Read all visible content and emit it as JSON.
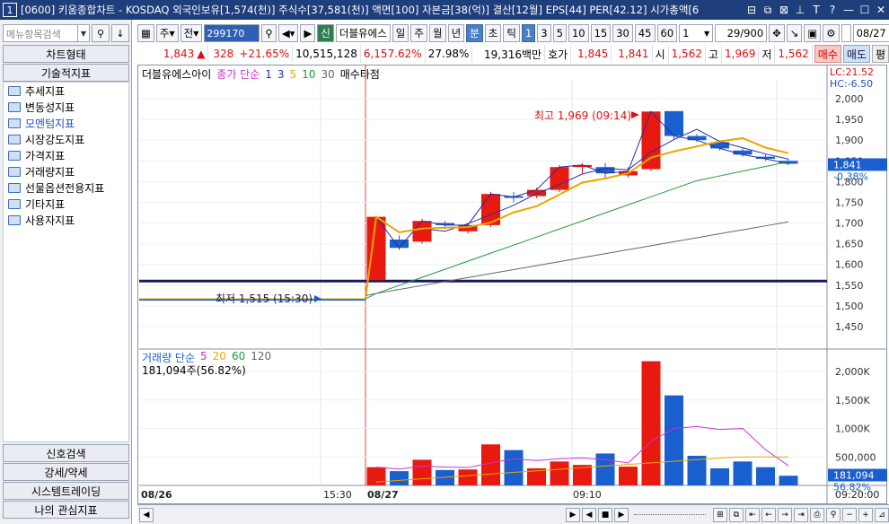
{
  "title": {
    "number": "1",
    "text": "[0600] 키움종합차트 - KOSDAQ 외국인보유[1,574(천)] 주식수[37,581(천)] 액면[100] 자본금[38(억)] 결산[12월] EPS[44] PER[42.12] 시가총액[6"
  },
  "sidebar": {
    "search_placeholder": "메뉴항목검색",
    "tab_chart_type": "차트형태",
    "tab_indicator": "기술적지표",
    "tree": [
      "추세지표",
      "변동성지표",
      "모멘텀지표",
      "시장강도지표",
      "가격지표",
      "거래량지표",
      "선물옵션전용지표",
      "기타지표",
      "사용자지표"
    ],
    "bottom_tabs": [
      "신호검색",
      "강세/약세",
      "시스템트레이딩",
      "나의 관심지표"
    ]
  },
  "toolbar": {
    "type1": "주",
    "type2": "전",
    "code": "299170",
    "sin": "신",
    "name": "더블유에스",
    "periods": [
      "일",
      "주",
      "월",
      "년",
      "분",
      "초",
      "틱"
    ],
    "minutes": [
      "1",
      "3",
      "5",
      "10",
      "15",
      "30",
      "45",
      "60"
    ],
    "mult": "1",
    "count": "29/900",
    "date": "08/27"
  },
  "quote": {
    "price": "1,843",
    "arrow": "▲",
    "change": "328",
    "rate": "+21.65%",
    "volume": "10,515,128",
    "vol_rate": "6,157.62%",
    "turnover": "27.98%",
    "amount": "19,316백만",
    "hoga_label": "호가",
    "ask": "1,845",
    "bid": "1,841",
    "open_l": "시",
    "open": "1,562",
    "high_l": "고",
    "high": "1,969",
    "low_l": "저",
    "low": "1,562",
    "buy": "매수",
    "sell": "매도",
    "eval": "평"
  },
  "legend": {
    "name": "더블유에스아이",
    "ma_label": "종가 단순",
    "ma": [
      "1",
      "3",
      "5",
      "10",
      "30"
    ],
    "signal": "매수타점"
  },
  "annotations": {
    "max": "최고 1,969 (09:14)",
    "min": "최저 1,515 (15:30)"
  },
  "price_axis": {
    "lc": "LC:21.52",
    "hc": "HC:-6.50",
    "ticks": [
      "2,000",
      "1,950",
      "1,900",
      "1,850",
      "1,800",
      "1,750",
      "1,700",
      "1,650",
      "1,600",
      "1,550",
      "1,500",
      "1,450"
    ],
    "current": "1,841",
    "current_rate": "-0.38%"
  },
  "volume": {
    "legend": "거래량 단순",
    "ma": [
      "5",
      "20",
      "60",
      "120"
    ],
    "value": "181,094주(56.82%)",
    "ticks": [
      "2,000K",
      "1,500K",
      "1,000K",
      "500,000"
    ],
    "current": "181,094",
    "rate": "56.82%"
  },
  "time_axis": {
    "labels": [
      "08/26",
      "15:30",
      "08/27",
      "09:10"
    ],
    "right": "09:20:00"
  },
  "colors": {
    "up": "#e8190f",
    "down": "#1a5fcf",
    "ma3": "#2233aa",
    "ma5": "#e8a800",
    "ma10": "#1d9b3a",
    "ma30": "#666666",
    "vol_ma5": "#cc33cc"
  },
  "chart_data": {
    "type": "candlestick",
    "candles": [
      {
        "o": 1562,
        "c": 1715,
        "h": 1715,
        "l": 1562
      },
      {
        "o": 1660,
        "c": 1640,
        "h": 1670,
        "l": 1635
      },
      {
        "o": 1655,
        "c": 1705,
        "h": 1710,
        "l": 1650
      },
      {
        "o": 1700,
        "c": 1695,
        "h": 1705,
        "l": 1685
      },
      {
        "o": 1680,
        "c": 1695,
        "h": 1700,
        "l": 1675
      },
      {
        "o": 1695,
        "c": 1770,
        "h": 1775,
        "l": 1690
      },
      {
        "o": 1765,
        "c": 1763,
        "h": 1775,
        "l": 1750
      },
      {
        "o": 1765,
        "c": 1780,
        "h": 1785,
        "l": 1760
      },
      {
        "o": 1780,
        "c": 1835,
        "h": 1840,
        "l": 1775
      },
      {
        "o": 1835,
        "c": 1840,
        "h": 1845,
        "l": 1820
      },
      {
        "o": 1835,
        "c": 1820,
        "h": 1845,
        "l": 1810
      },
      {
        "o": 1815,
        "c": 1825,
        "h": 1835,
        "l": 1810
      },
      {
        "o": 1830,
        "c": 1969,
        "h": 1969,
        "l": 1825
      },
      {
        "o": 1970,
        "c": 1910,
        "h": 1970,
        "l": 1900
      },
      {
        "o": 1910,
        "c": 1900,
        "h": 1915,
        "l": 1895
      },
      {
        "o": 1895,
        "c": 1880,
        "h": 1900,
        "l": 1875
      },
      {
        "o": 1875,
        "c": 1865,
        "h": 1880,
        "l": 1860
      },
      {
        "o": 1860,
        "c": 1855,
        "h": 1865,
        "l": 1850
      },
      {
        "o": 1850,
        "c": 1843,
        "h": 1855,
        "l": 1840
      }
    ],
    "volume_k": [
      320,
      250,
      450,
      270,
      280,
      720,
      620,
      300,
      420,
      360,
      560,
      330,
      2180,
      1580,
      520,
      300,
      420,
      320,
      170
    ]
  }
}
